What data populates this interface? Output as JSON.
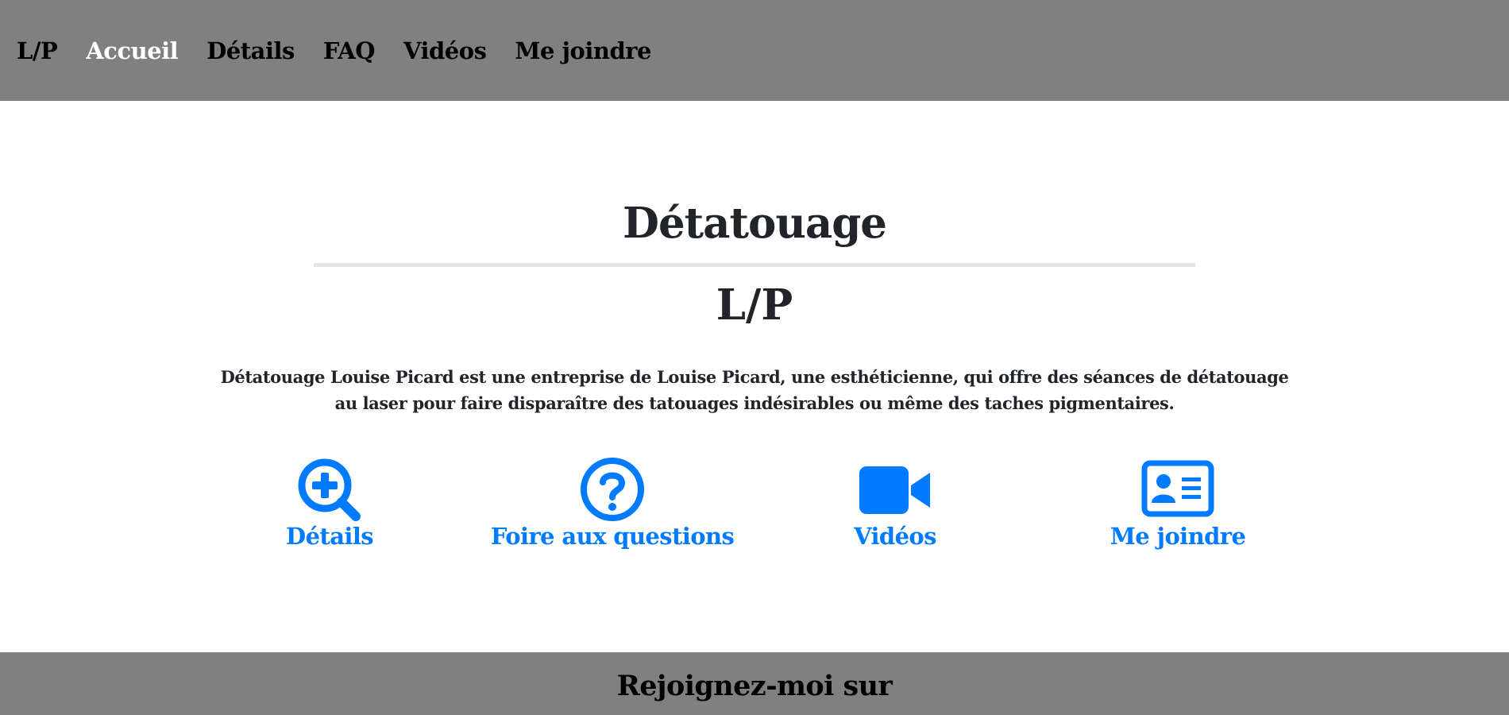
{
  "nav": {
    "brand": "L/P",
    "items": [
      {
        "label": "Accueil",
        "active": true
      },
      {
        "label": "Détails",
        "active": false
      },
      {
        "label": "FAQ",
        "active": false
      },
      {
        "label": "Vidéos",
        "active": false
      },
      {
        "label": "Me joindre",
        "active": false
      }
    ]
  },
  "main": {
    "title": "Détatouage",
    "subtitle": "L/P",
    "description": "Détatouage Louise Picard est une entreprise de Louise Picard, une esthéticienne, qui offre des séances de détatouage au laser pour faire disparaître des tatouages indésirables ou même des taches pigmentaires.",
    "features": [
      {
        "label": "Détails",
        "icon": "search-plus-icon"
      },
      {
        "label": "Foire aux questions",
        "icon": "question-circle-icon"
      },
      {
        "label": "Vidéos",
        "icon": "video-camera-icon"
      },
      {
        "label": "Me joindre",
        "icon": "contact-card-icon"
      }
    ]
  },
  "footer": {
    "title": "Rejoignez-moi sur"
  },
  "colors": {
    "nav_background": "#808080",
    "accent": "#007bff",
    "text": "#212529",
    "rule": "#e4e4e4",
    "active_nav": "#ffffff"
  }
}
